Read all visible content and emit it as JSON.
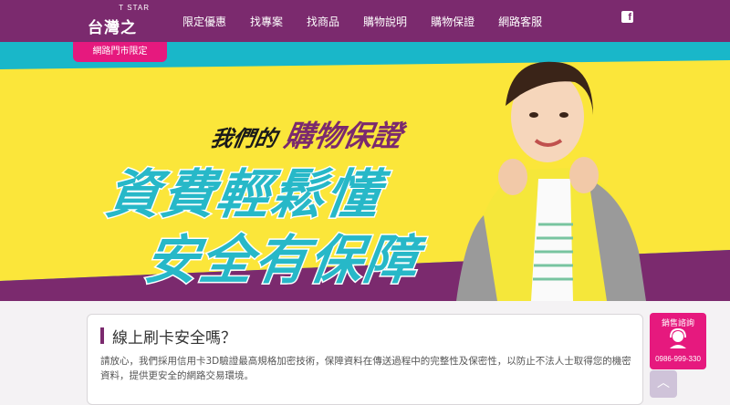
{
  "brand": {
    "tstar": "T STAR",
    "name": "台灣之星"
  },
  "nav": [
    {
      "label": "限定優惠"
    },
    {
      "label": "找專案"
    },
    {
      "label": "找商品"
    },
    {
      "label": "購物說明"
    },
    {
      "label": "購物保證"
    },
    {
      "label": "網路客服"
    }
  ],
  "social": {
    "facebook": "f"
  },
  "tab": {
    "label": "網路門市限定"
  },
  "banner": {
    "prefix": "我們的",
    "title": "購物保證",
    "line1": "資費輕鬆懂",
    "line2": "安全有保障"
  },
  "content": {
    "heading": "線上刷卡安全嗎？",
    "body": "請放心，我們採用信用卡3D驗證最高規格加密技術，保障資料在傳送過程中的完整性及保密性，以防止不法人士取得您的機密資料，提供更安全的網路交易環境。"
  },
  "sales": {
    "label": "銷售諮詢",
    "phone": "0986-999-330"
  },
  "scroll_top": {
    "icon": "︿"
  },
  "colors": {
    "brand": "#7b2a6e",
    "accent": "#e6197e",
    "teal": "#19b7c9",
    "yellow": "#fbe63a"
  }
}
